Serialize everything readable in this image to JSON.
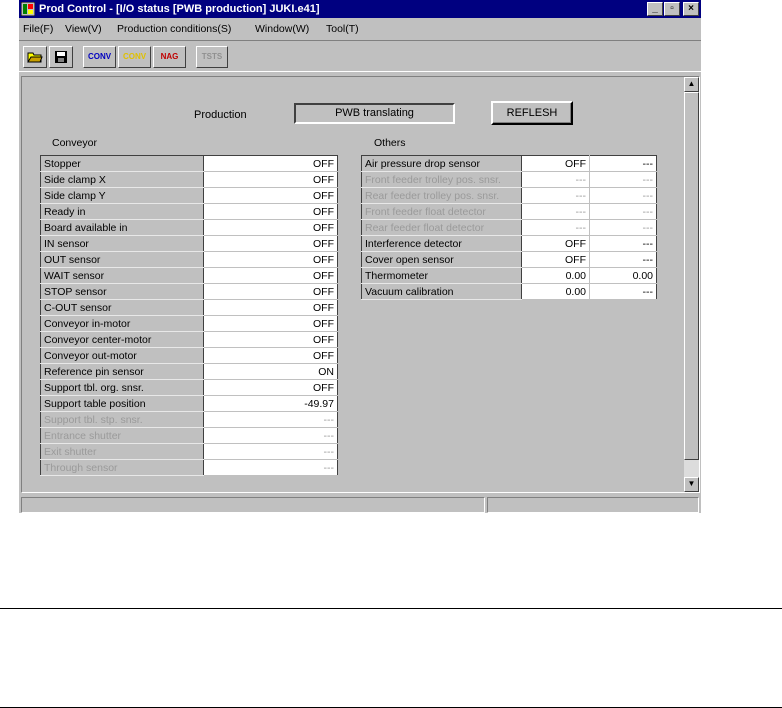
{
  "window": {
    "title": "Prod Control - [I/O status [PWB production] JUKI.e41]",
    "caption_buttons": [
      "_",
      "▫",
      "×"
    ]
  },
  "menubar": {
    "items": [
      "File(F)",
      "View(V)",
      "Production conditions(S)",
      "Window(W)",
      "Tool(T)"
    ]
  },
  "toolbar": {
    "buttons": [
      {
        "icon": "open-folder-icon",
        "label": "",
        "enabled": true
      },
      {
        "icon": "save-disk-icon",
        "label": "",
        "enabled": true
      },
      {
        "icon": "conv-icon",
        "label": "CONV",
        "enabled": true
      },
      {
        "icon": "conv-yellow-icon",
        "label": "CONV",
        "enabled": true
      },
      {
        "icon": "nag-icon",
        "label": "NAG",
        "enabled": true
      },
      {
        "icon": "disabled-tool-icon",
        "label": "TSTS",
        "enabled": false
      }
    ]
  },
  "production": {
    "label": "Production",
    "status": "PWB translating",
    "refresh_label": "REFLESH"
  },
  "conveyor": {
    "heading": "Conveyor",
    "rows": [
      {
        "name": "Stopper",
        "value": "OFF",
        "enabled": true
      },
      {
        "name": "Side clamp X",
        "value": "OFF",
        "enabled": true
      },
      {
        "name": "Side clamp Y",
        "value": "OFF",
        "enabled": true
      },
      {
        "name": "Ready in",
        "value": "OFF",
        "enabled": true
      },
      {
        "name": "Board available in",
        "value": "OFF",
        "enabled": true
      },
      {
        "name": "IN sensor",
        "value": "OFF",
        "enabled": true
      },
      {
        "name": "OUT sensor",
        "value": "OFF",
        "enabled": true
      },
      {
        "name": "WAIT sensor",
        "value": "OFF",
        "enabled": true
      },
      {
        "name": "STOP sensor",
        "value": "OFF",
        "enabled": true
      },
      {
        "name": "C-OUT sensor",
        "value": "OFF",
        "enabled": true
      },
      {
        "name": "Conveyor in-motor",
        "value": "OFF",
        "enabled": true
      },
      {
        "name": "Conveyor center-motor",
        "value": "OFF",
        "enabled": true
      },
      {
        "name": "Conveyor out-motor",
        "value": "OFF",
        "enabled": true
      },
      {
        "name": "Reference pin sensor",
        "value": "ON",
        "enabled": true
      },
      {
        "name": "Support tbl. org. snsr.",
        "value": "OFF",
        "enabled": true
      },
      {
        "name": "Support table position",
        "value": "-49.97",
        "enabled": true
      },
      {
        "name": "Support tbl. stp. snsr.",
        "value": "---",
        "enabled": false
      },
      {
        "name": "Entrance shutter",
        "value": "---",
        "enabled": false
      },
      {
        "name": "Exit shutter",
        "value": "---",
        "enabled": false
      },
      {
        "name": "Through sensor",
        "value": "---",
        "enabled": false
      }
    ]
  },
  "others": {
    "heading": "Others",
    "rows": [
      {
        "name": "Air pressure drop sensor",
        "value": "OFF",
        "value2": "---",
        "enabled": true
      },
      {
        "name": "Front feeder trolley pos. snsr.",
        "value": "---",
        "value2": "---",
        "enabled": false
      },
      {
        "name": "Rear feeder trolley pos. snsr.",
        "value": "---",
        "value2": "---",
        "enabled": false
      },
      {
        "name": "Front feeder float detector",
        "value": "---",
        "value2": "---",
        "enabled": false
      },
      {
        "name": "Rear feeder float detector",
        "value": "---",
        "value2": "---",
        "enabled": false
      },
      {
        "name": "Interference detector",
        "value": "OFF",
        "value2": "---",
        "enabled": true
      },
      {
        "name": "Cover open sensor",
        "value": "OFF",
        "value2": "---",
        "enabled": true
      },
      {
        "name": "Thermometer",
        "value": "0.00",
        "value2": "0.00",
        "enabled": true
      },
      {
        "name": "Vacuum calibration",
        "value": "0.00",
        "value2": "---",
        "enabled": true
      }
    ]
  },
  "scrollbar": {
    "up": "▲",
    "down": "▼"
  }
}
